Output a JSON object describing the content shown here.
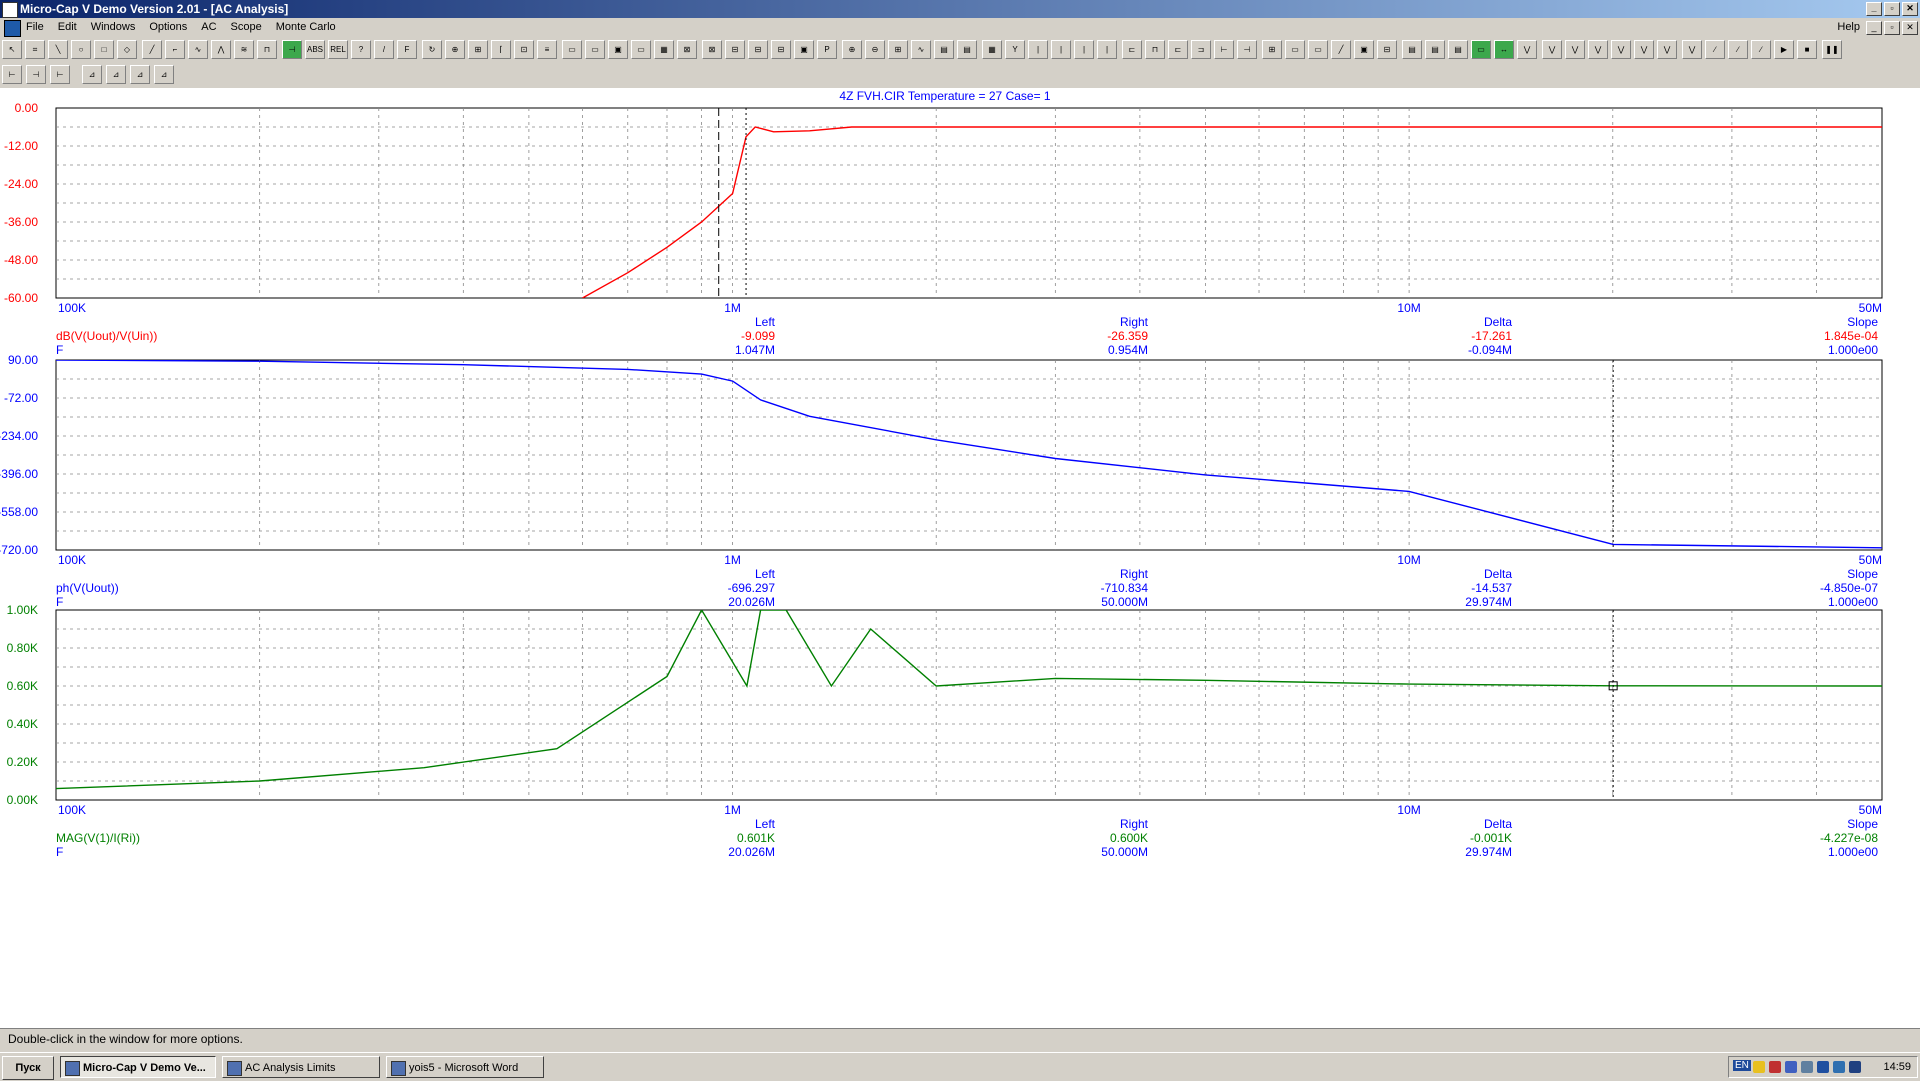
{
  "window": {
    "title": "Micro-Cap V Demo Version 2.01 - [AC Analysis]"
  },
  "menu": {
    "items": [
      "File",
      "Edit",
      "Windows",
      "Options",
      "AC",
      "Scope",
      "Monte Carlo"
    ],
    "help": "Help"
  },
  "plot_title": "4Z  FVH.CIR Temperature = 27 Case= 1",
  "x_ticks": [
    "100K",
    "1M",
    "10M",
    "50M"
  ],
  "colors": {
    "panel1": "#ff0000",
    "panel2": "#0000ff",
    "panel3": "#008000",
    "label_blue": "#0000ff"
  },
  "panels": [
    {
      "expr": "dB(V(Uout)/V(Uin))",
      "y_ticks": [
        "0.00",
        "-12.00",
        "-24.00",
        "-36.00",
        "-48.00",
        "-60.00"
      ],
      "ylim": [
        -60,
        0
      ],
      "readout": {
        "headers": [
          "Left",
          "Right",
          "Delta",
          "Slope"
        ],
        "expr_values": [
          "-9.099",
          "-26.359",
          "-17.261",
          "1.845e-04"
        ],
        "f_label": "F",
        "f_values": [
          "1.047M",
          "0.954M",
          "-0.094M",
          "1.000e00"
        ]
      }
    },
    {
      "expr": "ph(V(Uout))",
      "y_ticks": [
        "90.00",
        "-72.00",
        "-234.00",
        "-396.00",
        "-558.00",
        "-720.00"
      ],
      "ylim": [
        -720,
        90
      ],
      "readout": {
        "headers": [
          "Left",
          "Right",
          "Delta",
          "Slope"
        ],
        "expr_values": [
          "-696.297",
          "-710.834",
          "-14.537",
          "-4.850e-07"
        ],
        "f_label": "F",
        "f_values": [
          "20.026M",
          "50.000M",
          "29.974M",
          "1.000e00"
        ]
      }
    },
    {
      "expr": "MAG(V(1)/I(Ri))",
      "y_ticks": [
        "1.00K",
        "0.80K",
        "0.60K",
        "0.40K",
        "0.20K",
        "0.00K"
      ],
      "ylim": [
        0,
        1000
      ],
      "readout": {
        "headers": [
          "Left",
          "Right",
          "Delta",
          "Slope"
        ],
        "expr_values": [
          "0.601K",
          "0.600K",
          "-0.001K",
          "-4.227e-08"
        ],
        "f_label": "F",
        "f_values": [
          "20.026M",
          "50.000M",
          "29.974M",
          "1.000e00"
        ]
      }
    }
  ],
  "chart_data": [
    {
      "type": "line",
      "title": "4Z  FVH.CIR Temperature = 27 Case= 1",
      "xscale": "log",
      "xlim": [
        100000,
        50000000
      ],
      "ylim": [
        -60,
        0
      ],
      "grid": true,
      "series": [
        {
          "name": "dB(V(Uout)/V(Uin))",
          "x": [
            600000,
            700000,
            800000,
            900000,
            1000000,
            1047000,
            1080000,
            1150000,
            1300000,
            1500000,
            2000000,
            50000000
          ],
          "y": [
            -60,
            -52,
            -44,
            -36,
            -27,
            -9.1,
            -6,
            -7.5,
            -7.2,
            -6,
            -6,
            -6
          ]
        }
      ]
    },
    {
      "type": "line",
      "xscale": "log",
      "xlim": [
        100000,
        50000000
      ],
      "ylim": [
        -720,
        90
      ],
      "grid": true,
      "series": [
        {
          "name": "ph(V(Uout))",
          "x": [
            100000,
            200000,
            400000,
            700000,
            900000,
            1000000,
            1100000,
            1300000,
            2000000,
            3000000,
            5000000,
            10000000,
            20026000,
            50000000
          ],
          "y": [
            90,
            85,
            70,
            50,
            30,
            0,
            -80,
            -150,
            -250,
            -330,
            -400,
            -470,
            -696.297,
            -710.834
          ]
        }
      ]
    },
    {
      "type": "line",
      "xscale": "log",
      "xlim": [
        100000,
        50000000
      ],
      "ylim": [
        0,
        1000
      ],
      "grid": true,
      "series": [
        {
          "name": "MAG(V(1)/I(Ri))",
          "x": [
            100000,
            200000,
            350000,
            550000,
            800000,
            900000,
            1050000,
            1100000,
            1200000,
            1400000,
            1600000,
            2000000,
            3000000,
            5000000,
            10000000,
            20026000,
            50000000
          ],
          "y": [
            60,
            100,
            170,
            270,
            650,
            1000,
            600,
            1000,
            1000,
            600,
            900,
            600,
            640,
            630,
            610,
            601,
            600
          ]
        }
      ]
    }
  ]
}
